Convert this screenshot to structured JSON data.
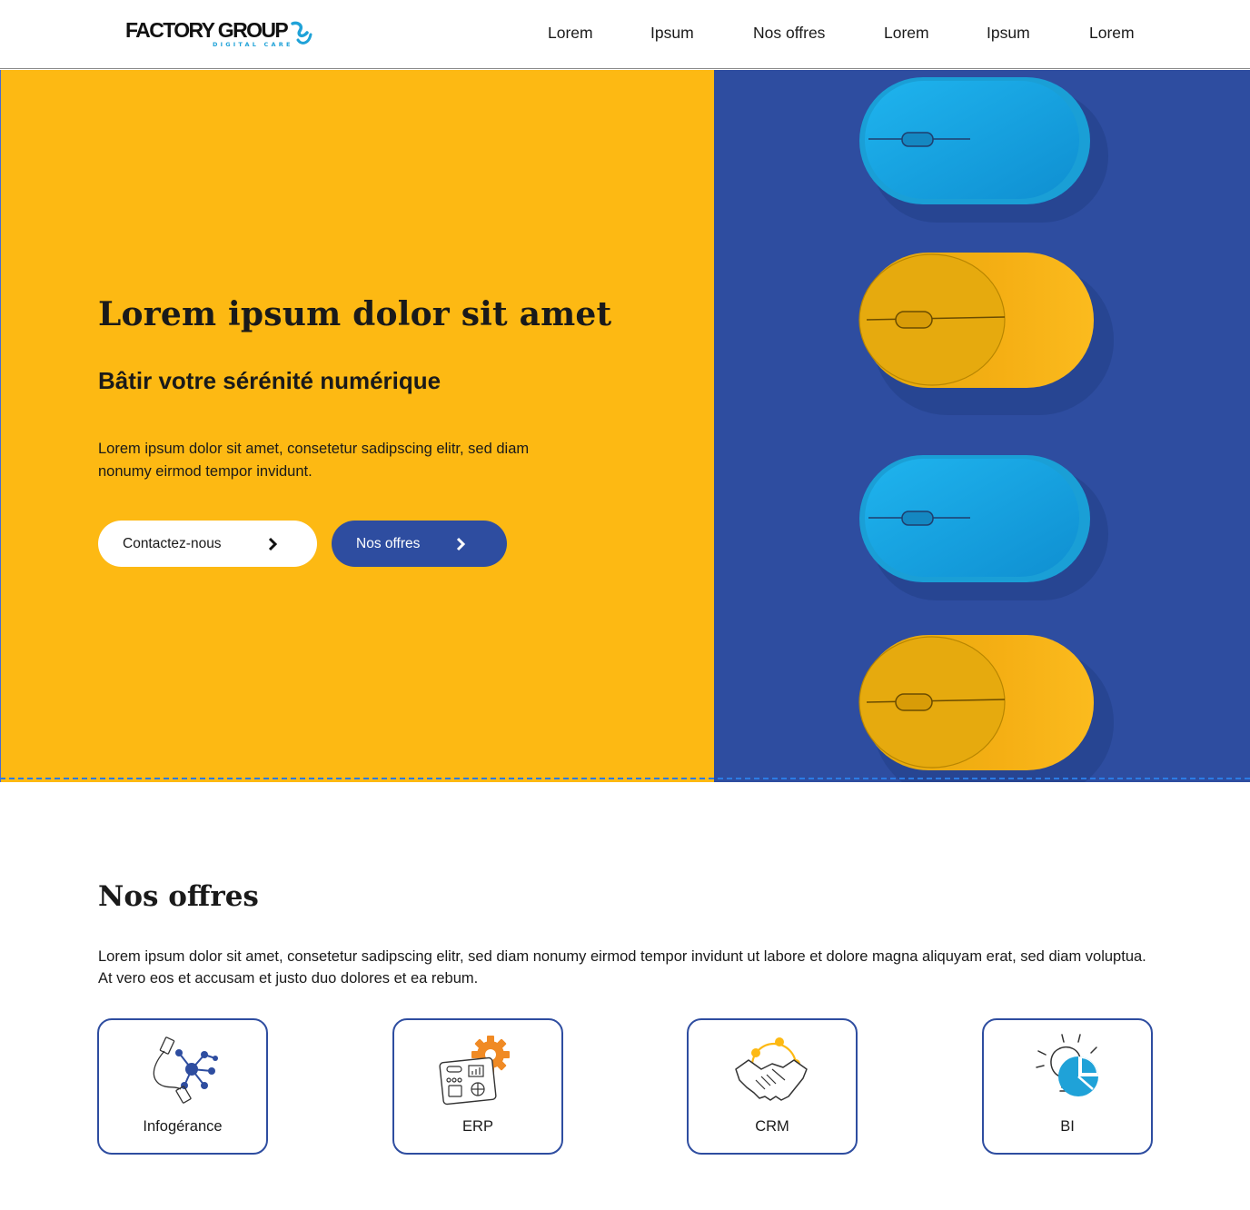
{
  "header": {
    "logo_text": "FACTORY GROUP",
    "logo_tagline": "DIGITAL CARE",
    "nav": [
      "Lorem",
      "Ipsum",
      "Nos offres",
      "Lorem",
      "Ipsum",
      "Lorem"
    ]
  },
  "hero": {
    "title": "Lorem ipsum dolor sit amet",
    "subtitle": "Bâtir votre sérénité numérique",
    "text": "Lorem ipsum dolor sit amet, consetetur sadipscing elitr, sed diam nonumy eirmod tempor invidunt.",
    "buttons": {
      "contact": "Contactez-nous",
      "offres": "Nos offres"
    },
    "image_icon": "computer-mouse-icon"
  },
  "offres": {
    "title": "Nos offres",
    "text": "Lorem ipsum dolor sit amet, consetetur sadipscing elitr, sed diam nonumy eirmod tempor invidunt ut labore et dolore magna aliquyam erat, sed diam voluptua. At vero eos et accusam et justo duo dolores et ea rebum.",
    "cards": [
      {
        "label": "Infogérance",
        "icon": "network-usb-icon"
      },
      {
        "label": "ERP",
        "icon": "dashboard-gear-icon"
      },
      {
        "label": "CRM",
        "icon": "handshake-icon"
      },
      {
        "label": "BI",
        "icon": "lightbulb-chart-icon"
      }
    ]
  },
  "colors": {
    "yellow": "#fdb913",
    "blue": "#2e4da0",
    "light_blue": "#1fa2d8",
    "orange": "#f08a24"
  }
}
